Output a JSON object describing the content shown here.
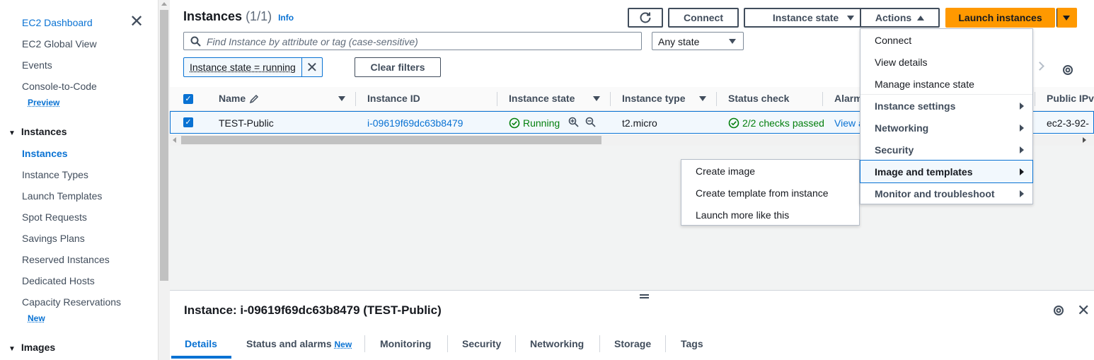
{
  "sidebar": {
    "top_items": [
      {
        "label": "EC2 Dashboard",
        "active": false
      },
      {
        "label": "EC2 Global View"
      },
      {
        "label": "Events"
      },
      {
        "label": "Console-to-Code"
      }
    ],
    "preview_badge": "Preview",
    "instances_section": "Instances",
    "instances_items": [
      {
        "label": "Instances"
      },
      {
        "label": "Instance Types"
      },
      {
        "label": "Launch Templates"
      },
      {
        "label": "Spot Requests"
      },
      {
        "label": "Savings Plans"
      },
      {
        "label": "Reserved Instances"
      },
      {
        "label": "Dedicated Hosts"
      },
      {
        "label": "Capacity Reservations"
      }
    ],
    "new_badge": "New",
    "images_section": "Images"
  },
  "header": {
    "title": "Instances",
    "count": "(1/1)",
    "info": "Info"
  },
  "toolbar": {
    "connect": "Connect",
    "instance_state": "Instance state",
    "actions": "Actions",
    "launch": "Launch instances"
  },
  "filter": {
    "search_placeholder": "Find Instance by attribute or tag (case-sensitive)",
    "state_select": "Any state",
    "token": "Instance state = running",
    "clear": "Clear filters"
  },
  "table": {
    "columns": [
      "Name",
      "Instance ID",
      "Instance state",
      "Instance type",
      "Status check",
      "Alarm",
      "Public IPv"
    ],
    "row": {
      "name": "TEST-Public",
      "instance_id": "i-09619f69dc63b8479",
      "state": "Running",
      "type": "t2.micro",
      "status": "2/2 checks passed",
      "alarm": "View a",
      "public_ip": "ec2-3-92-"
    }
  },
  "actions_menu": {
    "items": [
      {
        "label": "Connect",
        "submenu": false
      },
      {
        "label": "View details",
        "submenu": false
      },
      {
        "label": "Manage instance state",
        "submenu": false
      },
      {
        "label": "Instance settings",
        "submenu": true
      },
      {
        "label": "Networking",
        "submenu": true
      },
      {
        "label": "Security",
        "submenu": true
      },
      {
        "label": "Image and templates",
        "submenu": true
      },
      {
        "label": "Monitor and troubleshoot",
        "submenu": true
      }
    ]
  },
  "image_submenu": {
    "items": [
      "Create image",
      "Create template from instance",
      "Launch more like this"
    ]
  },
  "details": {
    "title": "Instance: i-09619f69dc63b8479 (TEST-Public)",
    "tabs": [
      "Details",
      "Status and alarms",
      "Monitoring",
      "Security",
      "Networking",
      "Storage",
      "Tags"
    ],
    "tab_new_badge": "New"
  },
  "colors": {
    "accent": "#0972d3",
    "primary_button": "#ff9900",
    "success": "#037f0c"
  }
}
